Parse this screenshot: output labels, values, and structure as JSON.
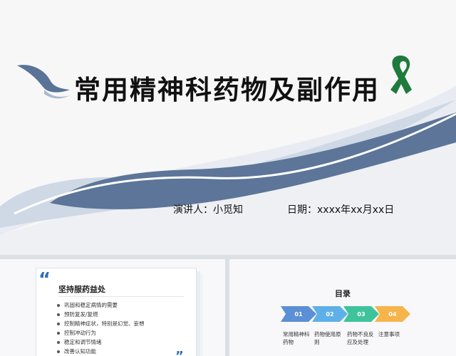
{
  "main_slide": {
    "title": "常用精神科药物及副作用",
    "presenter": "演讲人：小觅知",
    "date": "日期：xxxx年xx月xx日",
    "colors": {
      "wave": "#5c7599",
      "wave_light": "#ced8e6",
      "ribbon": "#1f7a3d",
      "bird": "#5a7396"
    }
  },
  "thumb_benefits": {
    "title": "坚持服药益处",
    "items": [
      "巩固和稳定病情的需要",
      "预防复发/复燃",
      "控制精神症状，特别是幻觉、妄想",
      "控制冲动行为",
      "稳定和调节情绪",
      "改善认知功能"
    ],
    "quote_open": "“",
    "quote_close": "”"
  },
  "thumb_toc": {
    "title": "目录",
    "steps": [
      {
        "num": "01",
        "label": "常用精神科药物",
        "color": "#5b8fd6"
      },
      {
        "num": "02",
        "label": "药物使用原则",
        "color": "#5fb0e8"
      },
      {
        "num": "03",
        "label": "药物不良反应及处理",
        "color": "#3fc39a"
      },
      {
        "num": "04",
        "label": "注意事项",
        "color": "#f6b44a"
      }
    ]
  }
}
